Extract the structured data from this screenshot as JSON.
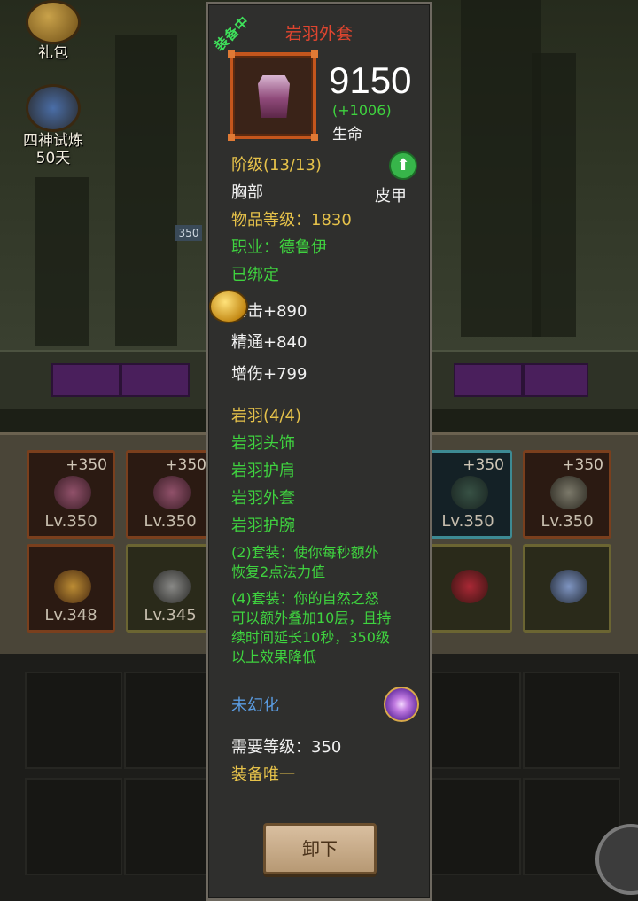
{
  "background": {
    "side_buttons": [
      {
        "label": "礼包"
      },
      {
        "label": "四神试炼"
      },
      {
        "label": "50天"
      }
    ],
    "hp_tag": "350",
    "slots_row1": [
      {
        "plus": "+350",
        "lv": "Lv.350"
      },
      {
        "plus": "+350",
        "lv": "Lv.350"
      },
      {
        "plus": "+350",
        "lv": "Lv.350"
      },
      {
        "plus": "+350",
        "lv": "Lv.350"
      }
    ],
    "slots_row2": [
      {
        "lv": "Lv.348"
      },
      {
        "lv": "Lv.345"
      }
    ]
  },
  "tooltip": {
    "equipped_label": "装备中",
    "item_name": "岩羽外套",
    "main_stat": {
      "value": "9150",
      "bonus": "(+1006)",
      "name": "生命"
    },
    "grade": "阶级(13/13)",
    "slot": "胸部",
    "armor_type": "皮甲",
    "item_level": "物品等级：1830",
    "class_req": "职业：德鲁伊",
    "bound": "已绑定",
    "stats": [
      "暴击+890",
      "精通+840",
      "增伤+799"
    ],
    "set": {
      "title": "岩羽(4/4)",
      "pieces": [
        "岩羽头饰",
        "岩羽护肩",
        "岩羽外套",
        "岩羽护腕"
      ],
      "bonus2": [
        "(2)套装：使你每秒额外",
        "恢复2点法力值"
      ],
      "bonus4": [
        "(4)套装：你的自然之怒",
        "可以额外叠加10层，且持",
        "续时间延长10秒，350级",
        "以上效果降低"
      ]
    },
    "transmog": "未幻化",
    "required_level": "需要等级：350",
    "unique": "装备唯一",
    "unequip_button": "卸下"
  }
}
